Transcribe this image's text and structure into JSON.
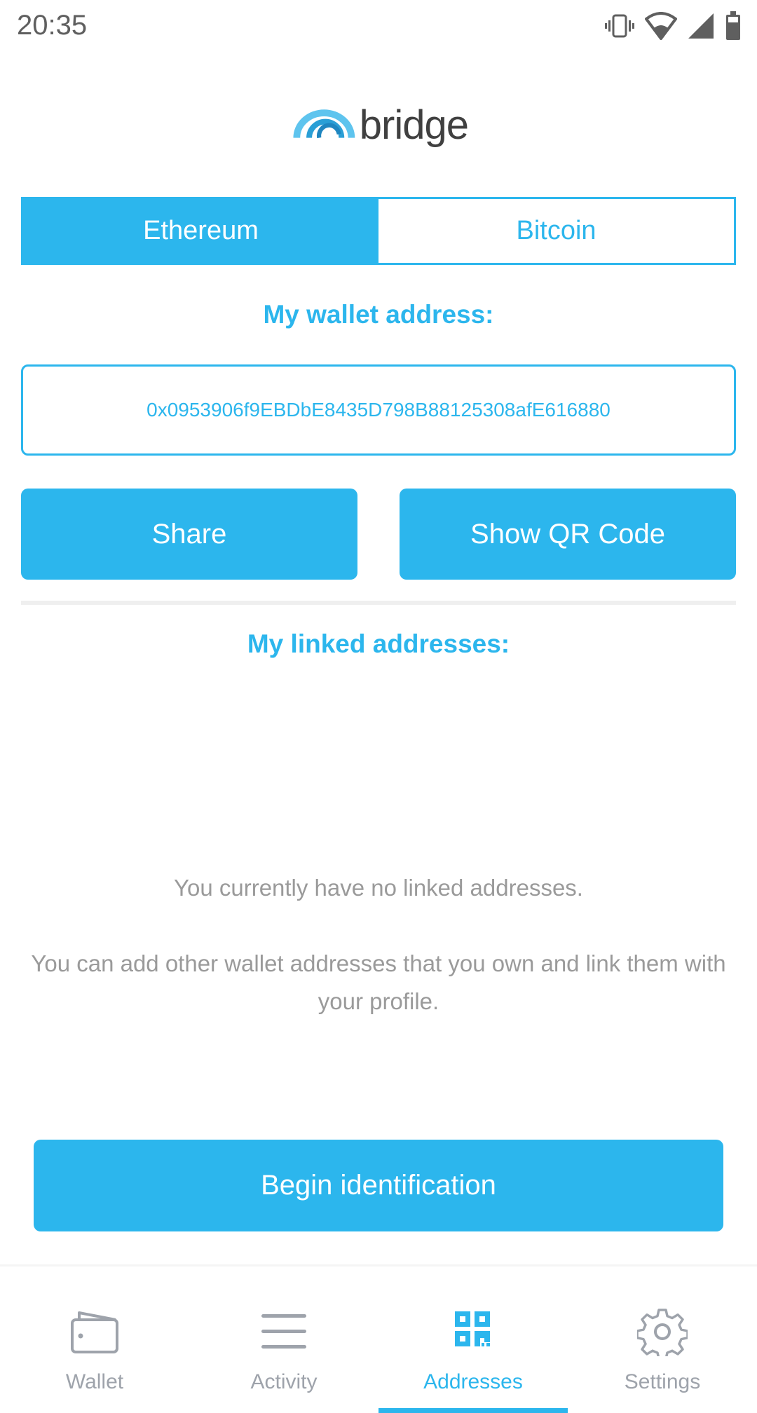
{
  "status_bar": {
    "time": "20:35",
    "icons": [
      "vibrate-icon",
      "wifi-icon",
      "signal-icon",
      "battery-icon"
    ]
  },
  "logo": {
    "text": "bridge",
    "icon": "bridge-arc-logo-icon"
  },
  "colors": {
    "accent": "#2cb6ed",
    "muted_text": "#9a9a9a",
    "nav_inactive": "#9ea3ab",
    "divider": "#efefef"
  },
  "currency_tabs": [
    {
      "label": "Ethereum",
      "active": true
    },
    {
      "label": "Bitcoin",
      "active": false
    }
  ],
  "wallet": {
    "heading": "My wallet address:",
    "address": "0x0953906f9EBDbE8435D798B88125308afE616880",
    "share_label": "Share",
    "qr_label": "Show QR Code"
  },
  "linked": {
    "heading": "My linked addresses:",
    "empty_message": "You currently have no linked addresses.",
    "help_text": "You can add other wallet addresses that you own and link them with your profile."
  },
  "begin_identification_label": "Begin identification",
  "bottom_nav": [
    {
      "label": "Wallet",
      "icon": "wallet-icon",
      "active": false
    },
    {
      "label": "Activity",
      "icon": "list-icon",
      "active": false
    },
    {
      "label": "Addresses",
      "icon": "qr-code-icon",
      "active": true
    },
    {
      "label": "Settings",
      "icon": "gear-icon",
      "active": false
    }
  ]
}
